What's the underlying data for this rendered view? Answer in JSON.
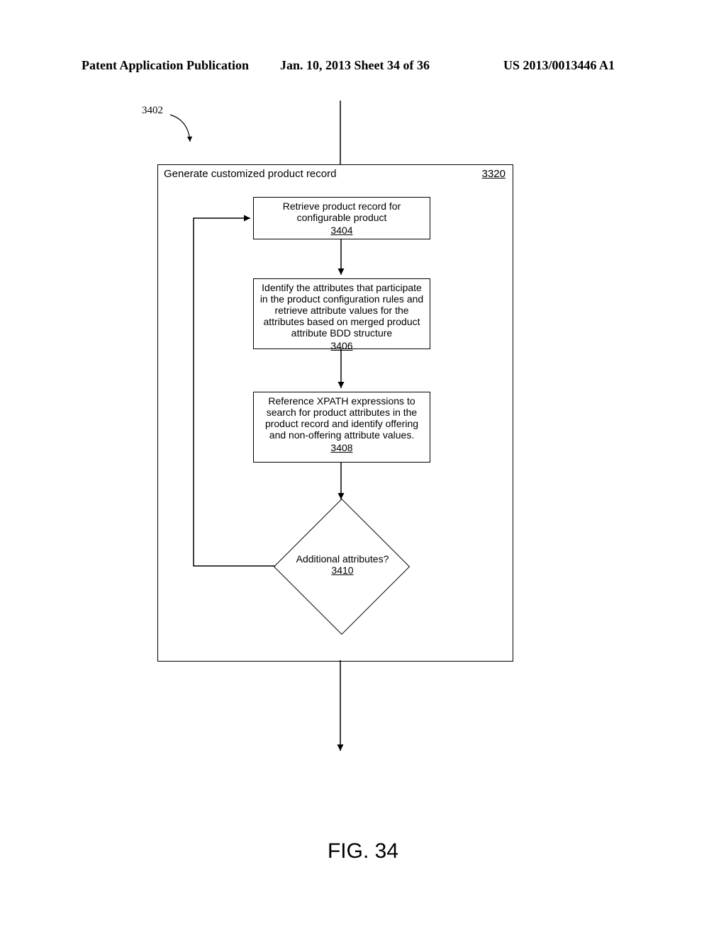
{
  "header": {
    "left": "Patent Application Publication",
    "center": "Jan. 10, 2013  Sheet 34 of 36",
    "right": "US 2013/0013446 A1"
  },
  "entry_ref": "3402",
  "container": {
    "title": "Generate customized product record",
    "ref": "3320"
  },
  "boxes": {
    "b3404": {
      "text": "Retrieve product record for configurable product",
      "ref": "3404"
    },
    "b3406": {
      "text": "Identify the attributes that participate in the product configuration rules and retrieve attribute values for the attributes based on merged product attribute BDD structure",
      "ref": "3406"
    },
    "b3408": {
      "text": "Reference XPATH expressions to search for product attributes in the product record and identify offering and non-offering attribute values.",
      "ref": "3408"
    }
  },
  "diamond": {
    "text": "Additional attributes?",
    "ref": "3410"
  },
  "figure_label": "FIG. 34"
}
